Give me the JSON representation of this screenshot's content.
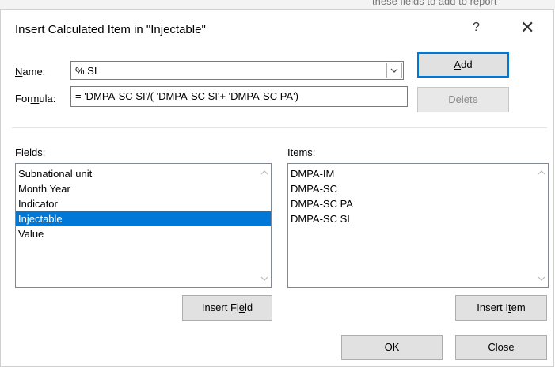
{
  "background": {
    "partial_text": "these fields to add to report"
  },
  "dialog": {
    "title": "Insert Calculated Item in \"Injectable\"",
    "help": "?",
    "close": "✕"
  },
  "name_label": {
    "pre": "",
    "acc": "N",
    "post": "ame:"
  },
  "name_value": "% SI",
  "formula_label": {
    "pre": "For",
    "acc": "m",
    "post": "ula:"
  },
  "formula_value": "= 'DMPA-SC SI'/( 'DMPA-SC SI'+ 'DMPA-SC PA')",
  "buttons": {
    "add": {
      "pre": "",
      "acc": "A",
      "post": "dd"
    },
    "delete": "Delete",
    "insert_field": {
      "pre": "Insert Fi",
      "acc": "e",
      "post": "ld"
    },
    "insert_item": {
      "pre": "Insert I",
      "acc": "t",
      "post": "em"
    },
    "ok": "OK",
    "close": "Close"
  },
  "fields_label": {
    "pre": "",
    "acc": "F",
    "post": "ields:"
  },
  "fields": [
    "Subnational unit",
    "Month Year",
    "Indicator",
    "Injectable",
    "Value"
  ],
  "fields_selected": "Injectable",
  "items_label": {
    "pre": "",
    "acc": "I",
    "post": "tems:"
  },
  "items": [
    "DMPA-IM",
    "DMPA-SC",
    "DMPA-SC PA",
    "DMPA-SC SI"
  ],
  "icons": {
    "dropdown": "chevron-down-icon",
    "scroll_up": "chevron-up-icon",
    "scroll_down": "chevron-down-icon"
  },
  "colors": {
    "accent": "#0078d7",
    "button_bg": "#e1e1e1",
    "disabled_text": "#8c8c8c"
  }
}
